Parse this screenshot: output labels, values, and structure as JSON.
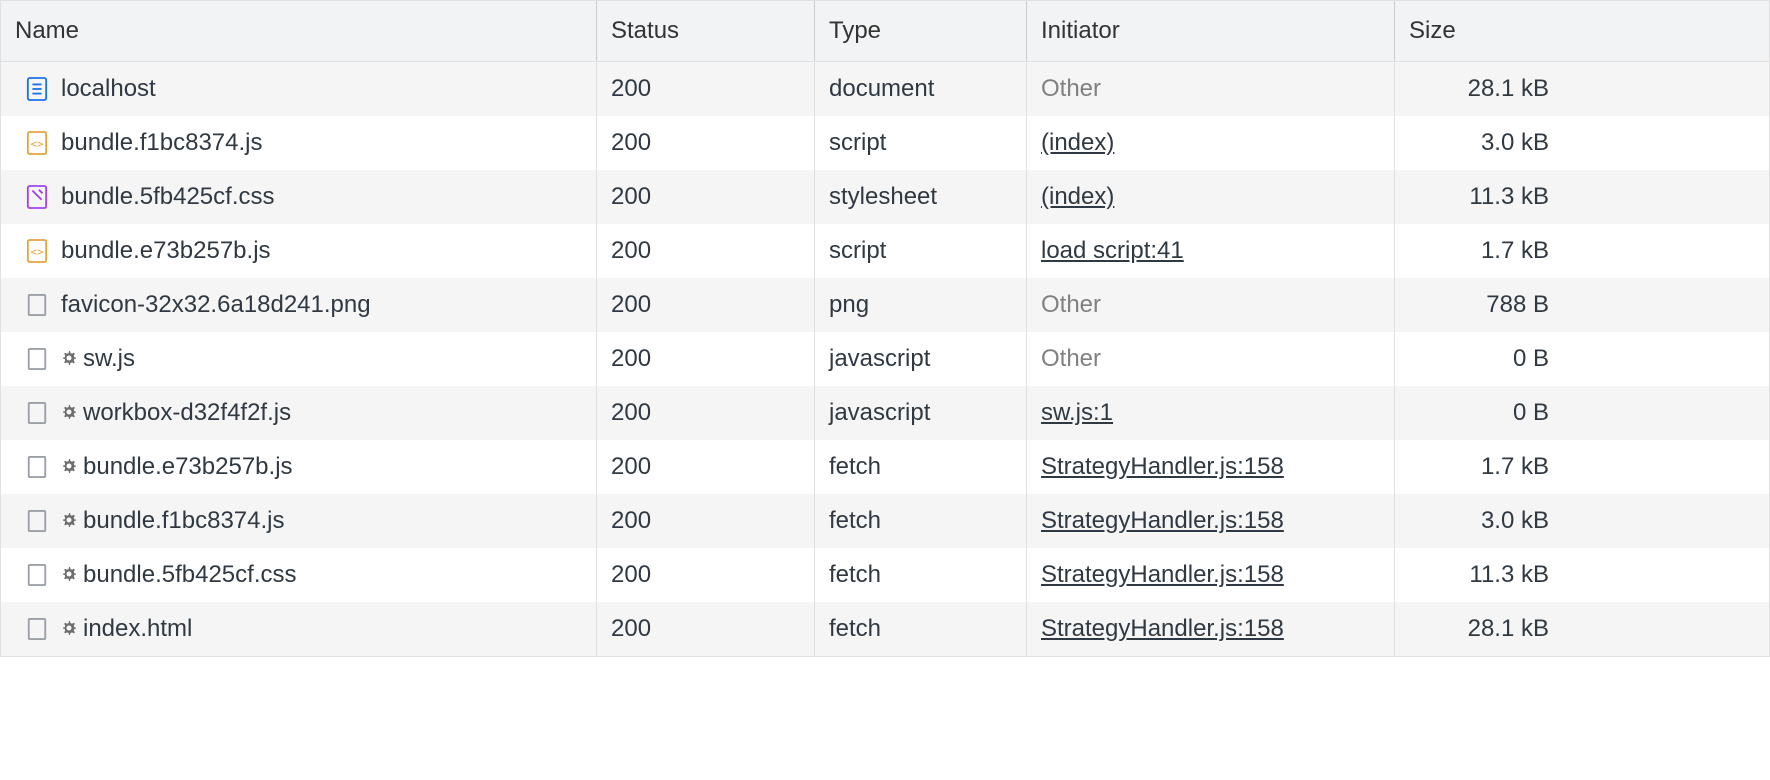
{
  "columns": {
    "name": "Name",
    "status": "Status",
    "type": "Type",
    "initiator": "Initiator",
    "size": "Size"
  },
  "rows": [
    {
      "icon": "document",
      "gear": false,
      "name": "localhost",
      "status": "200",
      "type": "document",
      "initiator": "Other",
      "initiatorLinked": false,
      "size": "28.1 kB"
    },
    {
      "icon": "js",
      "gear": false,
      "name": "bundle.f1bc8374.js",
      "status": "200",
      "type": "script",
      "initiator": "(index)",
      "initiatorLinked": true,
      "size": "3.0 kB"
    },
    {
      "icon": "css",
      "gear": false,
      "name": "bundle.5fb425cf.css",
      "status": "200",
      "type": "stylesheet",
      "initiator": "(index)",
      "initiatorLinked": true,
      "size": "11.3 kB"
    },
    {
      "icon": "js",
      "gear": false,
      "name": "bundle.e73b257b.js",
      "status": "200",
      "type": "script",
      "initiator": "load script:41",
      "initiatorLinked": true,
      "size": "1.7 kB"
    },
    {
      "icon": "generic",
      "gear": false,
      "name": "favicon-32x32.6a18d241.png",
      "status": "200",
      "type": "png",
      "initiator": "Other",
      "initiatorLinked": false,
      "size": "788 B"
    },
    {
      "icon": "generic",
      "gear": true,
      "name": "sw.js",
      "status": "200",
      "type": "javascript",
      "initiator": "Other",
      "initiatorLinked": false,
      "size": "0 B"
    },
    {
      "icon": "generic",
      "gear": true,
      "name": "workbox-d32f4f2f.js",
      "status": "200",
      "type": "javascript",
      "initiator": "sw.js:1",
      "initiatorLinked": true,
      "size": "0 B"
    },
    {
      "icon": "generic",
      "gear": true,
      "name": "bundle.e73b257b.js",
      "status": "200",
      "type": "fetch",
      "initiator": "StrategyHandler.js:158",
      "initiatorLinked": true,
      "size": "1.7 kB"
    },
    {
      "icon": "generic",
      "gear": true,
      "name": "bundle.f1bc8374.js",
      "status": "200",
      "type": "fetch",
      "initiator": "StrategyHandler.js:158",
      "initiatorLinked": true,
      "size": "3.0 kB"
    },
    {
      "icon": "generic",
      "gear": true,
      "name": "bundle.5fb425cf.css",
      "status": "200",
      "type": "fetch",
      "initiator": "StrategyHandler.js:158",
      "initiatorLinked": true,
      "size": "11.3 kB"
    },
    {
      "icon": "generic",
      "gear": true,
      "name": "index.html",
      "status": "200",
      "type": "fetch",
      "initiator": "StrategyHandler.js:158",
      "initiatorLinked": true,
      "size": "28.1 kB"
    }
  ]
}
